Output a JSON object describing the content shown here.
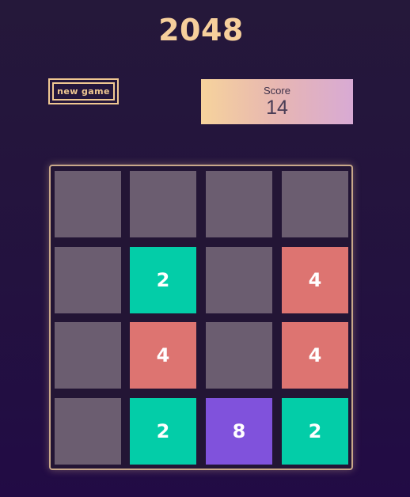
{
  "title": "2048",
  "controls": {
    "new_game_label": "new game"
  },
  "score": {
    "label": "Score",
    "value": "14"
  },
  "board": {
    "rows": [
      [
        "",
        "",
        "",
        ""
      ],
      [
        "",
        "2",
        "",
        "4"
      ],
      [
        "",
        "4",
        "",
        "4"
      ],
      [
        "",
        "2",
        "8",
        "2"
      ]
    ]
  },
  "colors": {
    "background": "#23123f",
    "title": "#f6cf9c",
    "empty_tile": "#6b5d70",
    "tile_2": "#03cda8",
    "tile_4": "#dd7471",
    "tile_8": "#8052dc"
  }
}
